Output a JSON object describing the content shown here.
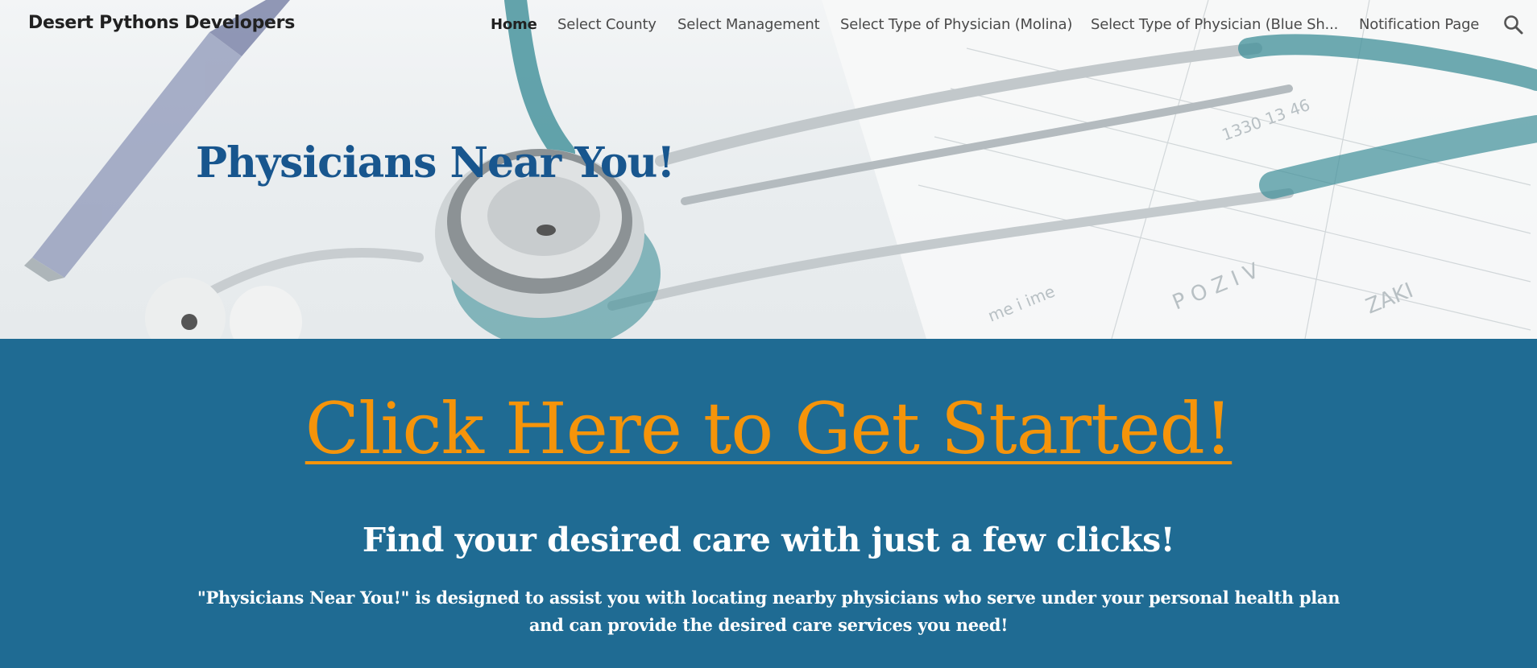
{
  "header": {
    "site_title": "Desert Pythons Developers",
    "nav": [
      {
        "label": "Home",
        "active": true
      },
      {
        "label": "Select County",
        "active": false
      },
      {
        "label": "Select Management",
        "active": false
      },
      {
        "label": "Select Type of Physician (Molina)",
        "active": false
      },
      {
        "label": "Select Type of Physician (Blue Sh...",
        "active": false
      },
      {
        "label": "Notification Page",
        "active": false
      }
    ],
    "search_icon": "search-icon"
  },
  "hero": {
    "title": "Physicians Near You!",
    "background": "stethoscope-photo"
  },
  "main": {
    "cta": "Click Here to Get Started!",
    "subheading": "Find your desired care with just a few clicks!",
    "description": "\"Physicians Near You!\" is designed to assist you with locating nearby physicians who serve under your personal health plan and can provide the desired care services you need!"
  },
  "colors": {
    "section_blue": "#1f6b93",
    "cta_orange": "#f5940a",
    "title_blue": "#18568e"
  }
}
